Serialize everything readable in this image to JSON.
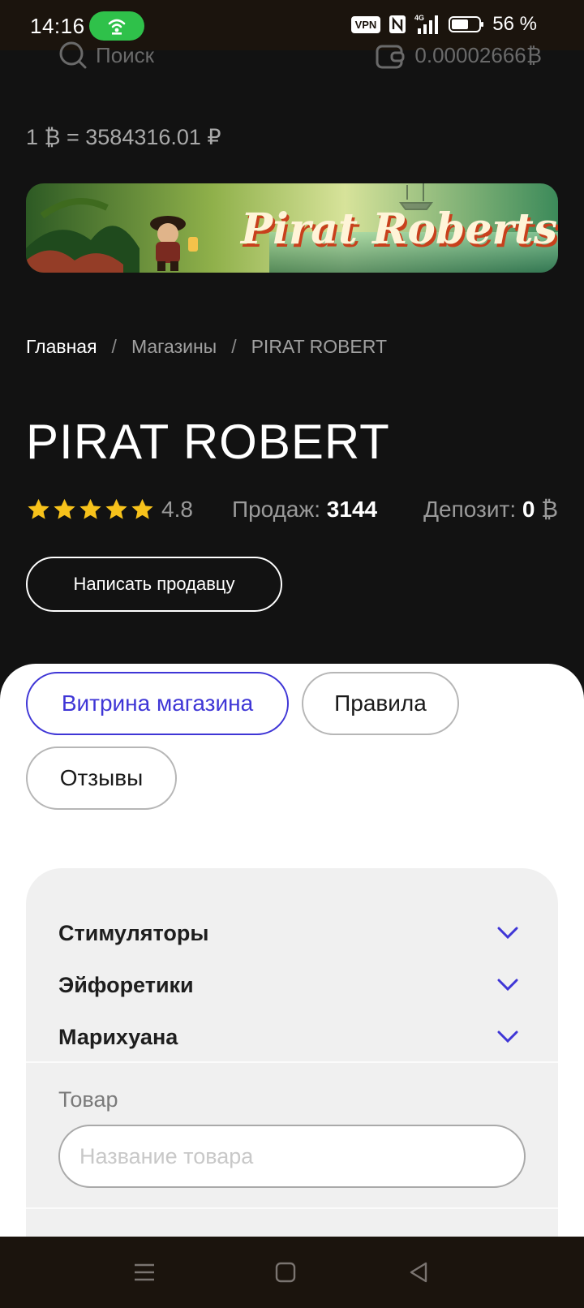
{
  "status_bar": {
    "time": "14:16",
    "vpn": "VPN",
    "network": "4G",
    "battery": "56 %"
  },
  "header": {
    "search_label": "Поиск",
    "balance": "0.00002666₿"
  },
  "rate": "1 ₿ = 3584316.01 ₽",
  "banner": {
    "text": "Pirat Roberts"
  },
  "breadcrumb": {
    "home": "Главная",
    "sep": "/",
    "shops": "Магазины",
    "current": "PIRAT ROBERT"
  },
  "shop": {
    "title": "PIRAT ROBERT",
    "rating": "4.8",
    "stars": 5,
    "sales_label": "Продаж:",
    "sales_value": "3144",
    "deposit_label": "Депозит:",
    "deposit_value": "0",
    "deposit_currency": "₿",
    "message_button": "Написать продавцу"
  },
  "tabs": {
    "storefront": "Витрина магазина",
    "rules": "Правила",
    "reviews": "Отзывы"
  },
  "filters": {
    "categories": [
      "Стимуляторы",
      "Эйфоретики",
      "Марихуана"
    ],
    "product_label": "Товар",
    "product_placeholder": "Название товара"
  },
  "colors": {
    "accent": "#3f36d6",
    "star": "#f7c21b",
    "background": "#121212",
    "status_pill": "#2fc14a"
  }
}
